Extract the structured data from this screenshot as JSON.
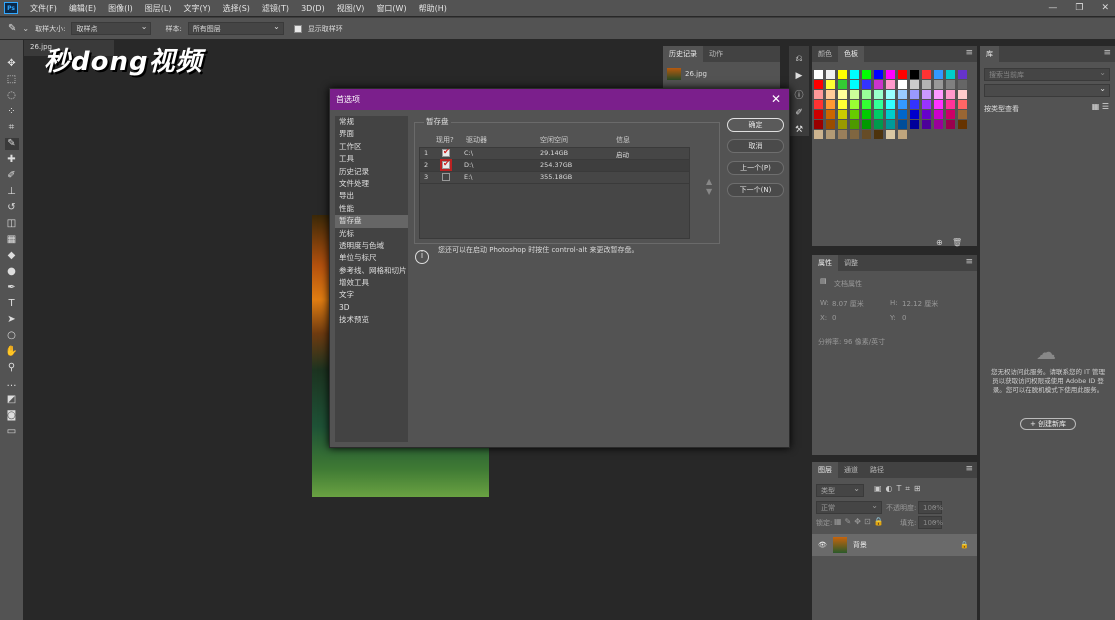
{
  "app": {
    "icon": "Ps"
  },
  "menu": [
    "文件(F)",
    "编辑(E)",
    "图像(I)",
    "图层(L)",
    "文字(Y)",
    "选择(S)",
    "滤镜(T)",
    "3D(D)",
    "视图(V)",
    "窗口(W)",
    "帮助(H)"
  ],
  "options": {
    "sample_size_label": "取样大小:",
    "sample_size_value": "取样点",
    "sample_label": "样本:",
    "sample_value": "所有图层",
    "show_ring_label": "显示取样环"
  },
  "document": {
    "tab": "26.jpg"
  },
  "watermark": "秒dong视频",
  "history": {
    "tabs": [
      "历史记录",
      "动作"
    ],
    "item": "26.jpg"
  },
  "swatches": {
    "tabs": [
      "颜色",
      "色板"
    ],
    "colors": [
      "#ffffff",
      "#f2f2f2",
      "#ffff00",
      "#00ffff",
      "#00ff00",
      "#0000ff",
      "#ff00ff",
      "#ff0000",
      "#000000",
      "#ff3333",
      "#3399ff",
      "#00cccc",
      "#6633cc",
      "#ff0000",
      "#ffff33",
      "#33cc33",
      "#00ffff",
      "#3333ff",
      "#cc33cc",
      "#ff99cc",
      "#ffffff",
      "#cccccc",
      "#b3b3b3",
      "#999999",
      "#808080",
      "#666666",
      "#ff9999",
      "#ffcc99",
      "#ffff99",
      "#ccff99",
      "#99ff99",
      "#99ffcc",
      "#99ffff",
      "#99ccff",
      "#9999ff",
      "#cc99ff",
      "#ff99ff",
      "#ff99cc",
      "#ffcccc",
      "#ff3333",
      "#ff9933",
      "#ffff33",
      "#99ff33",
      "#33ff33",
      "#33ff99",
      "#33ffff",
      "#3399ff",
      "#3333ff",
      "#9933ff",
      "#ff33ff",
      "#ff3399",
      "#ff6666",
      "#cc0000",
      "#cc6600",
      "#cccc00",
      "#66cc00",
      "#00cc00",
      "#00cc66",
      "#00cccc",
      "#0066cc",
      "#0000cc",
      "#6600cc",
      "#cc00cc",
      "#cc0066",
      "#996633",
      "#990000",
      "#994c00",
      "#999900",
      "#4d9900",
      "#009900",
      "#00994d",
      "#009999",
      "#004d99",
      "#000099",
      "#4c0099",
      "#990099",
      "#99004d",
      "#663300",
      "#ccb38f",
      "#b39a75",
      "#997f5b",
      "#806640",
      "#664c26",
      "#4d330d",
      "#d9c7a3",
      "#bfa57d"
    ]
  },
  "properties": {
    "tabs": [
      "属性",
      "调整"
    ],
    "doc_props": "文档属性",
    "w_label": "W:",
    "w_value": "8.07 厘米",
    "h_label": "H:",
    "h_value": "12.12 厘米",
    "x_label": "X:",
    "x_value": "0",
    "y_label": "Y:",
    "y_value": "0",
    "resolution": "分辨率: 96 像素/英寸"
  },
  "layers": {
    "tabs": [
      "图层",
      "通道",
      "路径"
    ],
    "filter": "类型",
    "blend": "正常",
    "opacity_label": "不透明度:",
    "opacity_value": "100%",
    "lock_label": "锁定:",
    "fill_label": "填充:",
    "fill_value": "100%",
    "layer_name": "背景"
  },
  "library": {
    "title": "库",
    "search_placeholder": "搜索当前库",
    "view": "按类型查看",
    "message": "您无权访问此服务。请联系您的 IT 管理员以获取访问权限或使用 Adobe ID 登录。您可以在脱机模式下使用此服务。",
    "create_button": "+ 创建新库"
  },
  "dialog": {
    "title": "首选项",
    "categories": [
      "常规",
      "界面",
      "工作区",
      "工具",
      "历史记录",
      "文件处理",
      "导出",
      "性能",
      "暂存盘",
      "光标",
      "透明度与色域",
      "单位与标尺",
      "参考线、网格和切片",
      "增效工具",
      "文字",
      "3D",
      "技术预览"
    ],
    "selected": 8,
    "section": "暂存盘",
    "headers": {
      "active": "现用?",
      "drive": "驱动器",
      "free": "空闲空间",
      "info": "信息"
    },
    "drives": [
      {
        "num": "1",
        "checked": true,
        "drive": "C:\\",
        "free": "29.14GB",
        "info": "启动"
      },
      {
        "num": "2",
        "checked": true,
        "drive": "D:\\",
        "free": "254.37GB",
        "info": ""
      },
      {
        "num": "3",
        "checked": false,
        "drive": "E:\\",
        "free": "355.18GB",
        "info": ""
      }
    ],
    "buttons": {
      "ok": "确定",
      "cancel": "取消",
      "prev": "上一个(P)",
      "next": "下一个(N)"
    },
    "info_text": "您还可以在启动 Photoshop 时按住 control-alt 来更改暂存盘。"
  }
}
